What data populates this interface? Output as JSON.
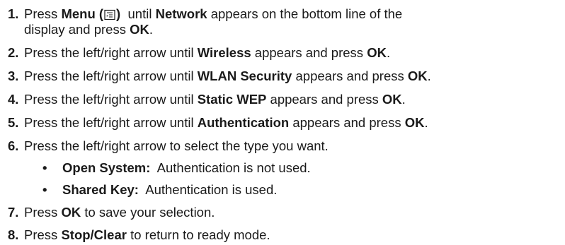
{
  "steps": [
    {
      "number": "1.",
      "parts": [
        {
          "t": "Press ",
          "b": false
        },
        {
          "t": "Menu (",
          "b": true
        },
        {
          "icon": "menu-icon"
        },
        {
          "t": ")",
          "b": true
        },
        {
          "t": "  until ",
          "b": false
        },
        {
          "t": "Network",
          "b": true
        },
        {
          "t": " appears on the bottom line of the",
          "b": false
        }
      ],
      "line2": "display and press ",
      "line2_bold": "OK",
      "line2_end": "."
    },
    {
      "number": "2.",
      "text": "Press the left/right arrow until ",
      "bold": "Wireless",
      "mid": " appears and press ",
      "bold2": "OK",
      "end": "."
    },
    {
      "number": "3.",
      "text": "Press the left/right arrow until ",
      "bold": "WLAN Security",
      "mid": " appears and press ",
      "bold2": "OK",
      "end": "."
    },
    {
      "number": "4.",
      "text": "Press the left/right arrow until ",
      "bold": "Static WEP",
      "mid": " appears and press ",
      "bold2": "OK",
      "end": "."
    },
    {
      "number": "5.",
      "text": "Press the left/right arrow until ",
      "bold": "Authentication",
      "mid": " appears and press ",
      "bold2": "OK",
      "end": "."
    },
    {
      "number": "6.",
      "text": "Press the left/right arrow to select the type you want."
    },
    {
      "number": "7.",
      "text": "Press ",
      "bold": "OK",
      "end": " to save your selection."
    },
    {
      "number": "8.",
      "text": "Press ",
      "bold": "Stop/Clear",
      "end": " to return to ready mode."
    }
  ],
  "options": [
    {
      "bullet": "•",
      "label": "Open System:",
      "desc": "  Authentication is not used."
    },
    {
      "bullet": "•",
      "label": "Shared Key:",
      "desc": "  Authentication is used."
    }
  ],
  "icons": {
    "menu": "menu-icon"
  }
}
